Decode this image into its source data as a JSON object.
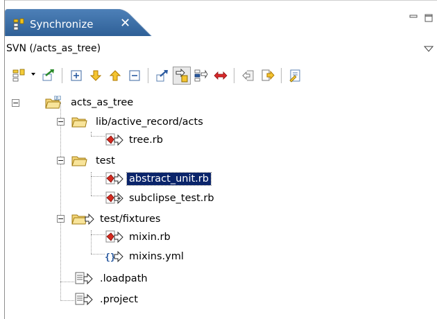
{
  "tab": {
    "title": "Synchronize"
  },
  "path": {
    "label": "SVN (/acts_as_tree)"
  },
  "toolbar": {
    "buttons": [
      "synchronize-icon",
      "commit-icon",
      "expand-all-icon",
      "next-change-icon",
      "previous-change-icon",
      "collapse-all-icon",
      "outgoing-mode-icon",
      "incoming-mode-icon",
      "incoming-outgoing-mode-icon",
      "conflicts-mode-icon",
      "pin-icon",
      "remove-icon",
      "settings-icon"
    ]
  },
  "tree": {
    "root": "acts_as_tree",
    "items": [
      {
        "label": "lib/active_record/acts",
        "type": "folder"
      },
      {
        "label": "tree.rb",
        "type": "ruby-file"
      },
      {
        "label": "test",
        "type": "folder"
      },
      {
        "label": "abstract_unit.rb",
        "type": "ruby-file",
        "selected": true
      },
      {
        "label": "subclipse_test.rb",
        "type": "ruby-file-added"
      },
      {
        "label": "test/fixtures",
        "type": "folder-outgoing"
      },
      {
        "label": "mixin.rb",
        "type": "ruby-file"
      },
      {
        "label": "mixins.yml",
        "type": "yml-file"
      },
      {
        "label": ".loadpath",
        "type": "text-file"
      },
      {
        "label": ".project",
        "type": "text-file"
      }
    ]
  },
  "colors": {
    "tab_fill": "#3a6ea5",
    "selection": "#0a246a"
  }
}
